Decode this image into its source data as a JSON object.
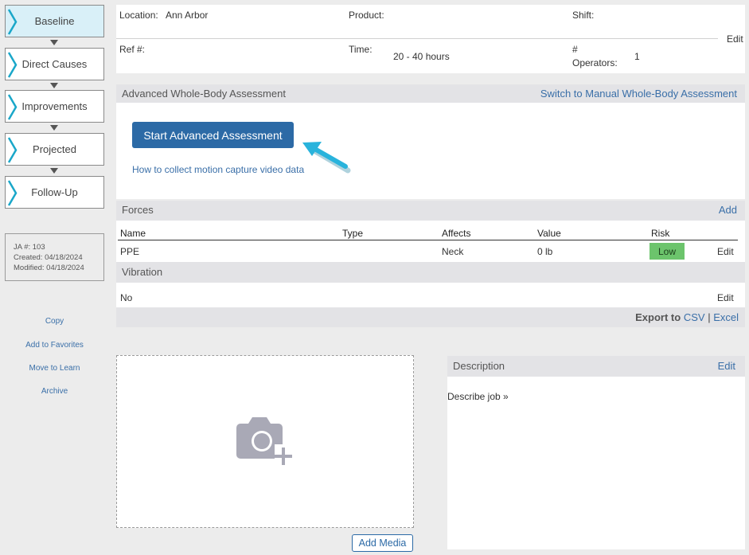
{
  "sidebar": {
    "steps": [
      {
        "label": "Baseline",
        "active": true
      },
      {
        "label": "Direct Causes",
        "active": false
      },
      {
        "label": "Improvements",
        "active": false
      },
      {
        "label": "Projected",
        "active": false
      },
      {
        "label": "Follow-Up",
        "active": false
      }
    ],
    "info": {
      "ja": "JA #: 103",
      "created": "Created: 04/18/2024",
      "modified": "Modified: 04/18/2024"
    },
    "links": [
      "Copy",
      "Add to Favorites",
      "Move to Learn",
      "Archive"
    ]
  },
  "header": {
    "location_label": "Location:",
    "location_value": "Ann Arbor",
    "product_label": "Product:",
    "shift_label": "Shift:",
    "edit": "Edit",
    "ref_label": "Ref #:",
    "time_label": "Time:",
    "time_value": "20 - 40 hours",
    "operators_label_1": "#",
    "operators_label_2": "Operators:",
    "operators_value": "1"
  },
  "assessment": {
    "title": "Advanced Whole-Body Assessment",
    "switch_link": "Switch to Manual Whole-Body Assessment",
    "start_button": "Start Advanced Assessment",
    "help_link": "How to collect motion capture video data"
  },
  "forces": {
    "title": "Forces",
    "add": "Add",
    "columns": [
      "Name",
      "Type",
      "Affects",
      "Value",
      "Risk"
    ],
    "rows": [
      {
        "name": "PPE",
        "type": "",
        "affects": "Neck",
        "value": "0 lb",
        "risk": "Low",
        "edit": "Edit"
      }
    ]
  },
  "vibration": {
    "title": "Vibration",
    "value": "No",
    "edit": "Edit"
  },
  "export": {
    "label": "Export to",
    "csv": "CSV",
    "sep": "|",
    "excel": "Excel"
  },
  "media": {
    "add_button": "Add Media"
  },
  "description": {
    "title": "Description",
    "edit": "Edit",
    "link": "Describe job »"
  },
  "colors": {
    "accent": "#2c6aa6",
    "link": "#3a6fa8",
    "active_step": "#d9f0f8",
    "chevron": "#1aa7c9",
    "risk_low": "#6cc46c",
    "pointer_arrow": "#29b3dc"
  }
}
